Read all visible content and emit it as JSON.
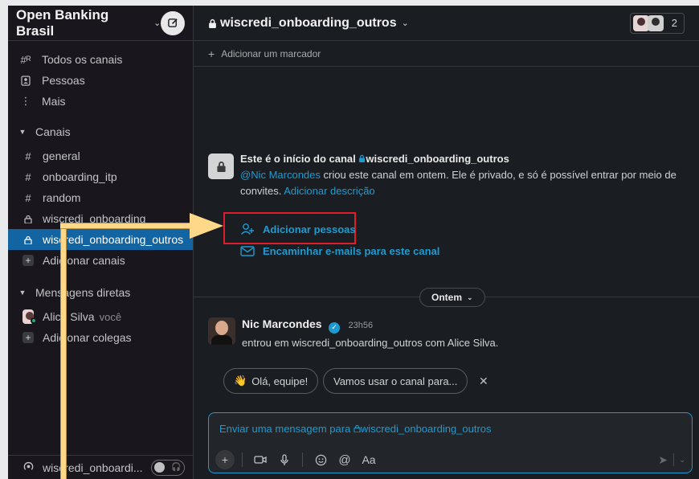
{
  "workspace": {
    "name": "Open Banking Brasil"
  },
  "sidebar": {
    "nav": [
      {
        "label": "Todos os canais",
        "icon": "channel-browse-icon"
      },
      {
        "label": "Pessoas",
        "icon": "people-icon"
      },
      {
        "label": "Mais",
        "icon": "more-icon"
      }
    ],
    "channels_section": "Canais",
    "channels": [
      {
        "label": "general",
        "icon": "hash-icon"
      },
      {
        "label": "onboarding_itp",
        "icon": "hash-icon"
      },
      {
        "label": "random",
        "icon": "hash-icon"
      },
      {
        "label": "wiscredi_onboarding",
        "icon": "lock-icon"
      },
      {
        "label": "wiscredi_onboarding_outros",
        "icon": "lock-icon",
        "active": true
      }
    ],
    "add_channels": "Adicionar canais",
    "dm_section": "Mensagens diretas",
    "dm_user": "Alice Silva",
    "dm_you": "você",
    "add_colleagues": "Adicionar colegas",
    "footer_channel": "wiscredi_onboardi..."
  },
  "channel": {
    "title": "wiscredi_onboarding_outros",
    "member_count": "2",
    "add_bookmark": "Adicionar um marcador"
  },
  "intro": {
    "heading_prefix": "Este é o início do canal",
    "heading_channel": "wiscredi_onboarding_outros",
    "mention": "@Nic Marcondes",
    "body": " criou este canal em ontem. Ele é privado, e só é possível entrar por meio de convites. ",
    "add_description": "Adicionar descrição",
    "add_people": "Adicionar pessoas",
    "forward_emails": "Encaminhar e-mails para este canal"
  },
  "date_divider": "Ontem",
  "message": {
    "author": "Nic Marcondes",
    "time": "23h56",
    "text": "entrou em wiscredi_onboarding_outros com Alice Silva."
  },
  "suggestions": [
    {
      "emoji": "👋",
      "label": "Olá, equipe!"
    },
    {
      "emoji": "",
      "label": "Vamos usar o canal para..."
    }
  ],
  "composer": {
    "placeholder_prefix": "Enviar uma mensagem para ",
    "placeholder_channel": "wiscredi_onboarding_outros",
    "format_label": "Aa"
  },
  "colors": {
    "accent": "#1d9bd1",
    "active_item": "#1264a3",
    "highlight_box": "#e01e2b",
    "annotation_arrow": "#ffd88a"
  }
}
